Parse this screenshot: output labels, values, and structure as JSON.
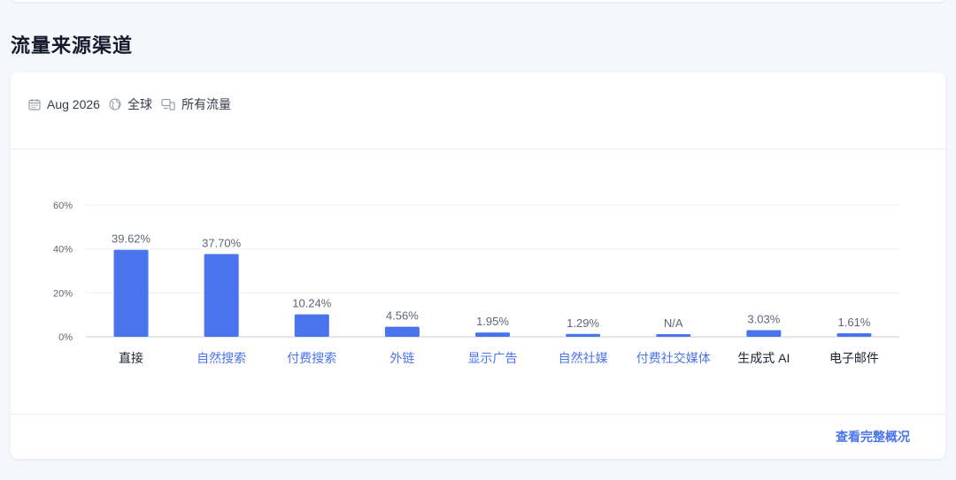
{
  "section": {
    "title": "流量来源渠道"
  },
  "filters": [
    {
      "icon": "calendar-icon",
      "label": "Aug 2026"
    },
    {
      "icon": "globe-icon",
      "label": "全球"
    },
    {
      "icon": "devices-icon",
      "label": "所有流量"
    }
  ],
  "footer": {
    "link_label": "查看完整概况"
  },
  "colors": {
    "bar": "#4a73ee",
    "link": "#4a73ee",
    "text": "#1b2330",
    "muted": "#5e6675"
  },
  "chart_data": {
    "type": "bar",
    "categories": [
      "直接",
      "自然搜索",
      "付费搜索",
      "外链",
      "显示广告",
      "自然社媒",
      "付费社交媒体",
      "生成式 AI",
      "电子邮件"
    ],
    "category_links": [
      false,
      true,
      true,
      true,
      true,
      true,
      true,
      false,
      false
    ],
    "values": [
      39.62,
      37.7,
      10.24,
      4.56,
      1.95,
      1.29,
      null,
      3.03,
      1.61
    ],
    "data_labels": [
      "39.62%",
      "37.70%",
      "10.24%",
      "4.56%",
      "1.95%",
      "1.29%",
      "N/A",
      "3.03%",
      "1.61%"
    ],
    "yticks": [
      0,
      20,
      40,
      60
    ],
    "ytick_labels": [
      "0%",
      "20%",
      "40%",
      "60%"
    ],
    "ylim": [
      0,
      60
    ],
    "grid": true,
    "title": "",
    "xlabel": "",
    "ylabel": ""
  }
}
